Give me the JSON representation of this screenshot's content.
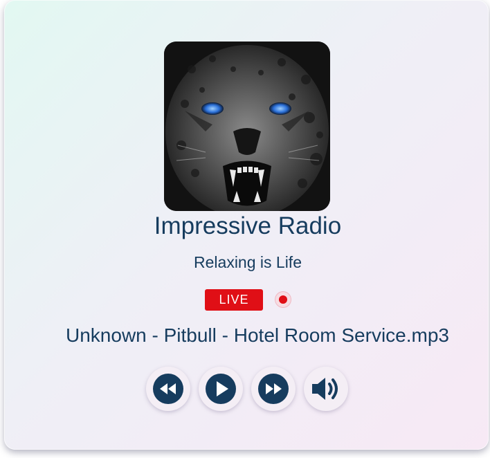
{
  "station": {
    "name": "Impressive Radio",
    "tagline": "Relaxing is Life",
    "live_label": "LIVE",
    "now_playing": "Unknown - Pitbull - Hotel Room Service.mp3"
  },
  "controls": {
    "rewind_icon": "rewind-icon",
    "play_icon": "play-icon",
    "forward_icon": "fast-forward-icon",
    "volume_icon": "volume-icon"
  },
  "colors": {
    "accent": "#163c5e",
    "live": "#e00f16"
  }
}
